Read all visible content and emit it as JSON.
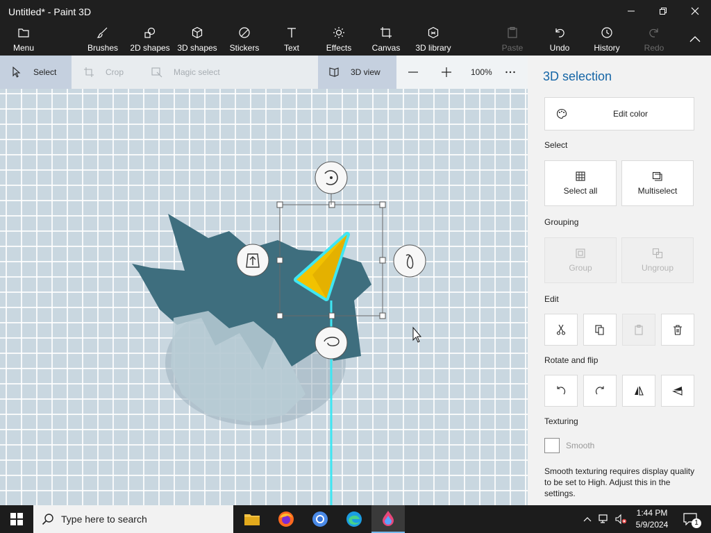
{
  "window": {
    "title": "Untitled* - Paint 3D"
  },
  "ribbon": {
    "menu": "Menu",
    "brushes": "Brushes",
    "shapes2d": "2D shapes",
    "shapes3d": "3D shapes",
    "stickers": "Stickers",
    "text": "Text",
    "effects": "Effects",
    "canvas": "Canvas",
    "library3d": "3D library",
    "paste": "Paste",
    "undo": "Undo",
    "history": "History",
    "redo": "Redo"
  },
  "toolbar": {
    "select": "Select",
    "crop": "Crop",
    "magic_select": "Magic select",
    "view3d": "3D view",
    "zoom": "100%"
  },
  "panel": {
    "title": "3D selection",
    "edit_color": "Edit color",
    "select_label": "Select",
    "select_all": "Select all",
    "multiselect": "Multiselect",
    "grouping_label": "Grouping",
    "group": "Group",
    "ungroup": "Ungroup",
    "edit_label": "Edit",
    "rotate_label": "Rotate and flip",
    "texturing_label": "Texturing",
    "smooth": "Smooth",
    "note": "Smooth texturing requires display quality to be set to High. Adjust this in the settings."
  },
  "taskbar": {
    "search_placeholder": "Type here to search",
    "time": "1:44 PM",
    "date": "5/9/2024",
    "notification_count": "1"
  },
  "colors": {
    "accent": "#1565a6",
    "selected_tool_bg": "#c5d0df",
    "cone_yellow": "#f2c200",
    "highlight_cyan": "#3fe6f2",
    "shape_teal": "#3e6e7e"
  }
}
